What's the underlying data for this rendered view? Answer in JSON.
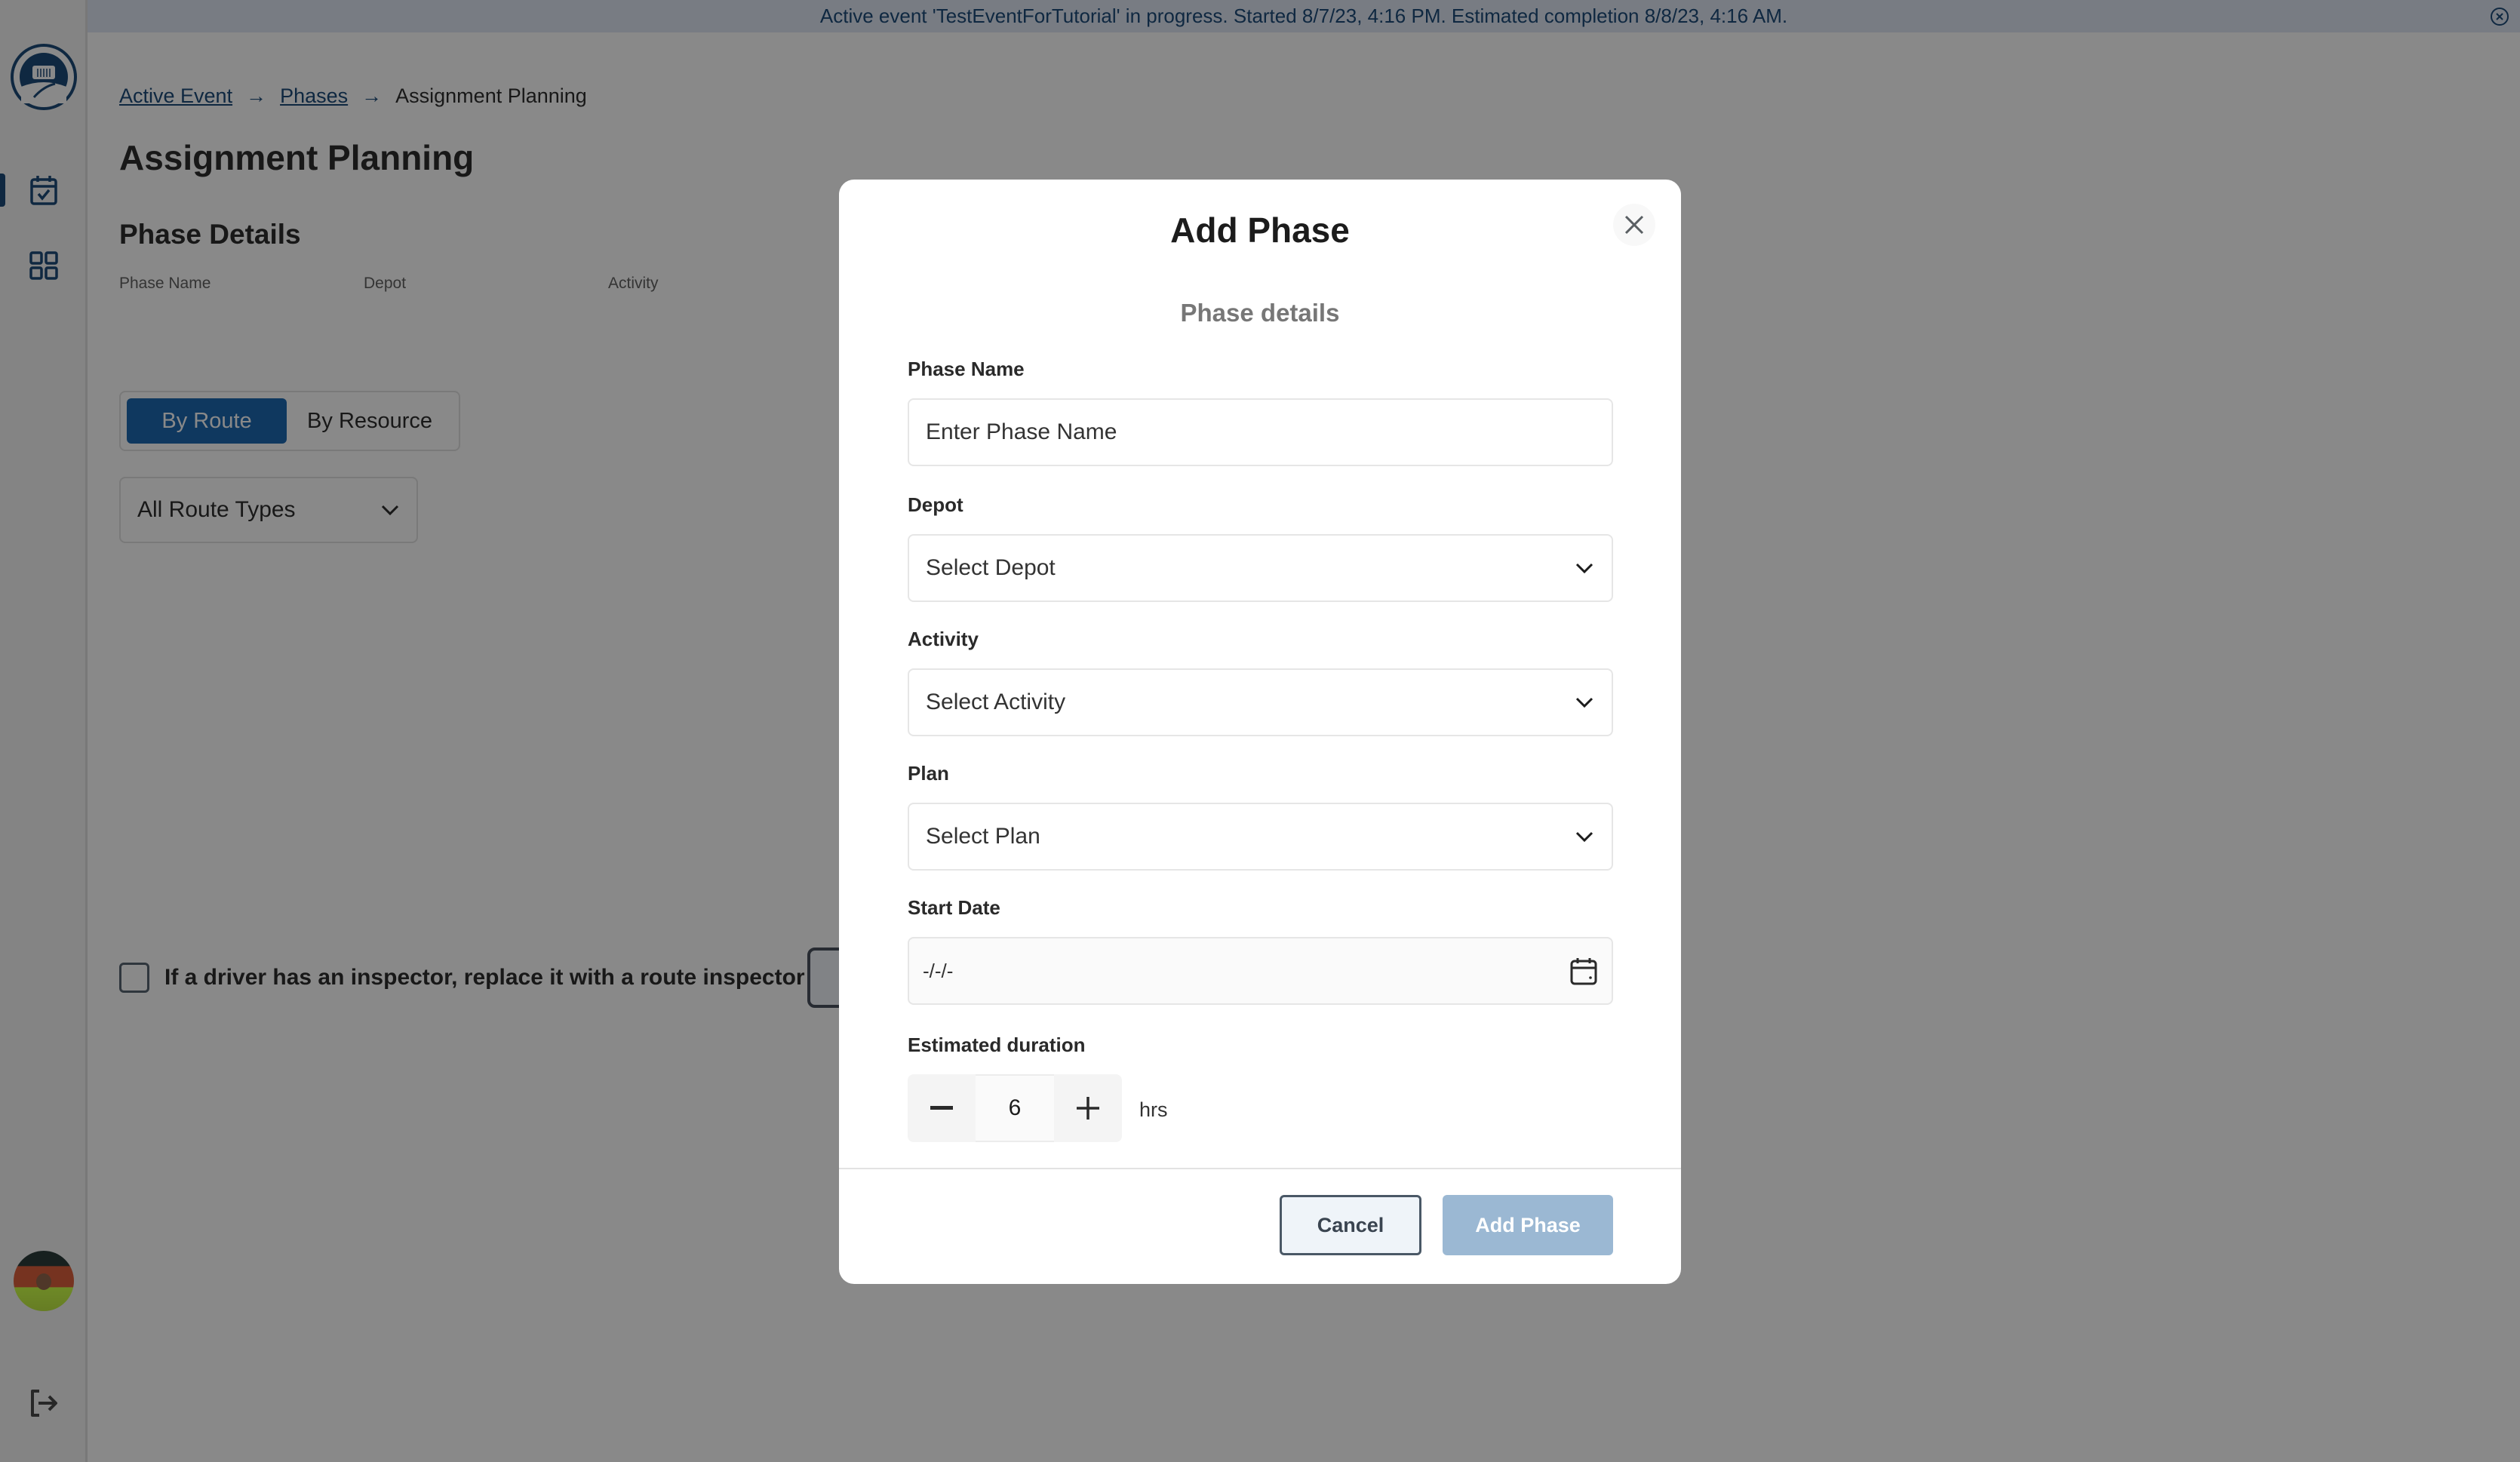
{
  "banner": {
    "text": "Active event 'TestEventForTutorial' in progress. Started 8/7/23, 4:16 PM. Estimated completion 8/8/23, 4:16 AM.",
    "close_icon": "close-circle-icon"
  },
  "sidebar": {
    "logo": "truck-logo",
    "items": [
      {
        "name": "calendar-check",
        "icon": "calendar-check-icon",
        "active": true
      },
      {
        "name": "grid",
        "icon": "grid-icon",
        "active": false
      }
    ],
    "avatar": "user-avatar",
    "logout_icon": "logout-icon"
  },
  "breadcrumb": {
    "items": [
      {
        "label": "Active Event",
        "link": true
      },
      {
        "label": "Phases",
        "link": true
      },
      {
        "label": "Assignment Planning",
        "link": false
      }
    ],
    "separator": "→"
  },
  "page": {
    "title": "Assignment Planning",
    "section_title": "Phase Details",
    "detail_labels": [
      "Phase Name",
      "Depot",
      "Activity"
    ],
    "toggle": {
      "options": [
        "By Route",
        "By Resource"
      ],
      "selected": "By Route"
    },
    "route_type_select": {
      "value": "All Route Types"
    },
    "checkbox": {
      "label": "If a driver has an inspector, replace it with a route inspector",
      "checked": false
    }
  },
  "modal": {
    "title": "Add Phase",
    "subtitle": "Phase details",
    "fields": {
      "phase_name": {
        "label": "Phase Name",
        "placeholder": "Enter Phase Name",
        "value": ""
      },
      "depot": {
        "label": "Depot",
        "placeholder": "Select Depot"
      },
      "activity": {
        "label": "Activity",
        "placeholder": "Select Activity"
      },
      "plan": {
        "label": "Plan",
        "placeholder": "Select Plan"
      },
      "start_date": {
        "label": "Start Date",
        "placeholder": "-/-/-"
      },
      "estimated_duration": {
        "label": "Estimated duration",
        "value": "6",
        "unit": "hrs"
      }
    },
    "buttons": {
      "cancel": "Cancel",
      "submit": "Add Phase"
    },
    "colors": {
      "primary": "#0b5cab",
      "disabled_primary": "#9bb8d3",
      "brand_navy": "#0b3d6e"
    }
  }
}
